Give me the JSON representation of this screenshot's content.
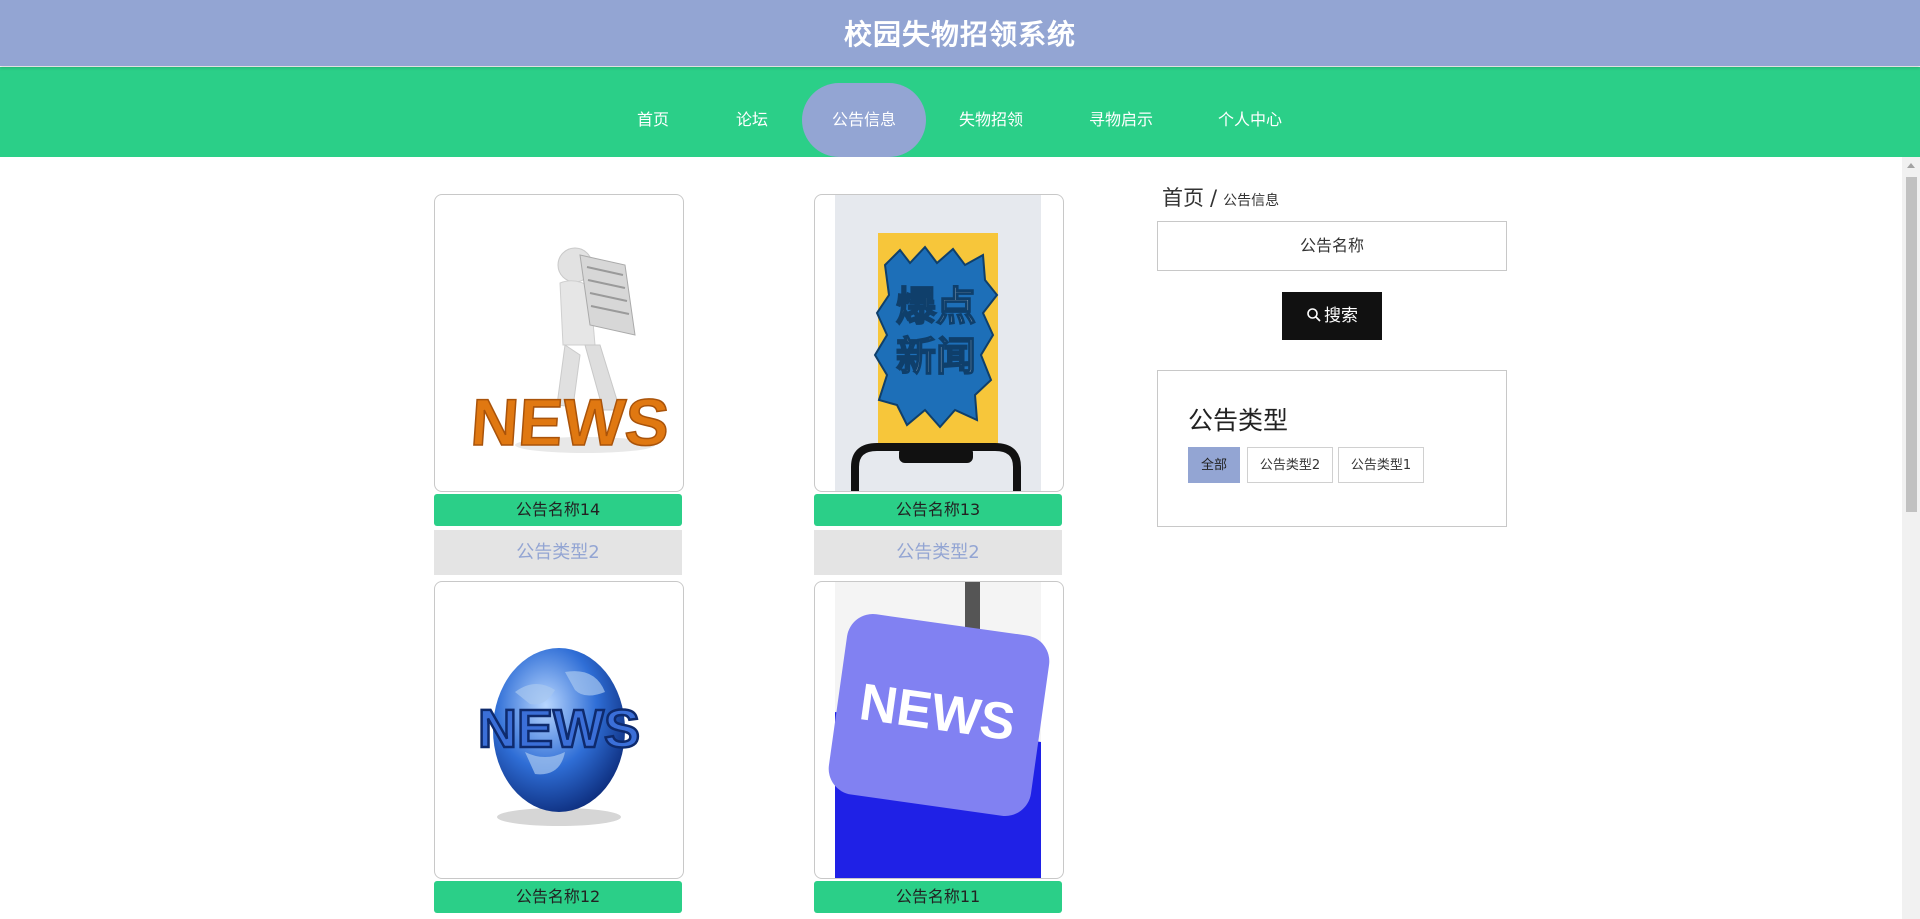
{
  "header": {
    "title": "校园失物招领系统"
  },
  "nav": {
    "items": [
      {
        "label": "首页"
      },
      {
        "label": "论坛"
      },
      {
        "label": "公告信息",
        "active": true
      },
      {
        "label": "失物招领"
      },
      {
        "label": "寻物启示"
      },
      {
        "label": "个人中心"
      }
    ]
  },
  "cards": [
    {
      "name": "公告名称14",
      "type": "公告类型2",
      "image": "news-figure-reading"
    },
    {
      "name": "公告名称13",
      "type": "公告类型2",
      "image": "breaking-news-phone",
      "image_text": "爆点新闻"
    },
    {
      "name": "公告名称12",
      "type": "",
      "image": "news-globe",
      "image_text": "NEWS"
    },
    {
      "name": "公告名称11",
      "type": "",
      "image": "news-keyboard-key",
      "image_text": "NEWS"
    }
  ],
  "breadcrumb": {
    "home": "首页",
    "separator": "/",
    "current": "公告信息"
  },
  "search": {
    "placeholder": "公告名称",
    "button_label": "搜索"
  },
  "type_filter": {
    "title": "公告类型",
    "options": [
      {
        "label": "全部",
        "active": true
      },
      {
        "label": "公告类型2"
      },
      {
        "label": "公告类型1"
      }
    ]
  },
  "colors": {
    "header_bg": "#93a5d3",
    "nav_bg": "#2bcf88",
    "accent": "#93a5d3",
    "button_dark": "#111111"
  }
}
